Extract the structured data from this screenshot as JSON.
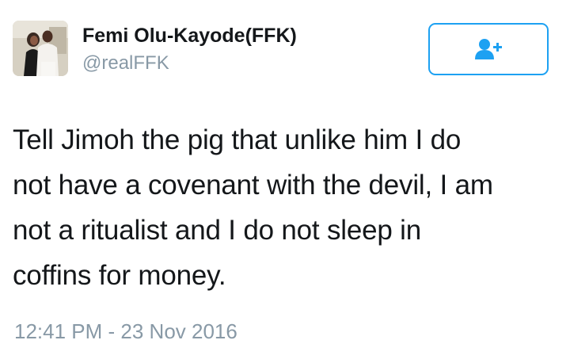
{
  "user": {
    "display_name": "Femi Olu-Kayode(FFK)",
    "handle": "@realFFK",
    "avatar_icon": "profile-photo"
  },
  "follow_button": {
    "icon": "follow-user-icon",
    "accent_color": "#1da1f2"
  },
  "tweet": {
    "text": "Tell Jimoh the pig that unlike  him I do\nnot have a covenant with the devil, I am\nnot a ritualist and I do not sleep in\ncoffins for money.",
    "timestamp": "12:41 PM - 23 Nov 2016"
  },
  "colors": {
    "text": "#14171a",
    "secondary_text": "#8899a6",
    "accent": "#1da1f2"
  }
}
